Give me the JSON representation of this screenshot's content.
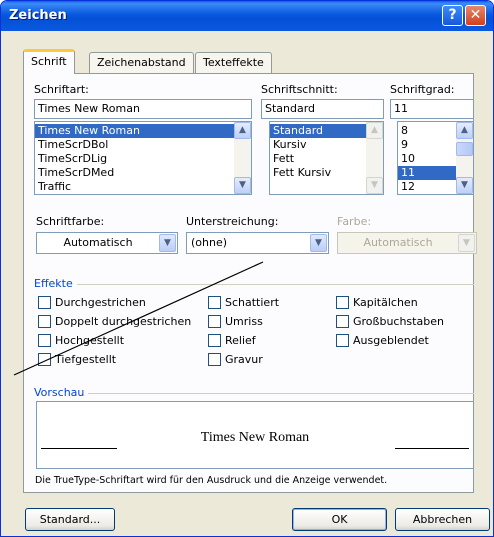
{
  "window": {
    "title": "Zeichen",
    "help_symbol": "?",
    "close_symbol": "✕"
  },
  "tabs": [
    {
      "label": "Schrift",
      "active": true
    },
    {
      "label": "Zeichenabstand",
      "active": false
    },
    {
      "label": "Texteffekte",
      "active": false
    }
  ],
  "font": {
    "label": "Schriftart:",
    "value": "Times New Roman",
    "items": [
      "Times New Roman",
      "TimeScrDBol",
      "TimeScrDLig",
      "TimeScrDMed",
      "Traffic"
    ]
  },
  "style": {
    "label": "Schriftschnitt:",
    "value": "Standard",
    "items": [
      "Standard",
      "Kursiv",
      "Fett",
      "Fett Kursiv"
    ]
  },
  "size": {
    "label": "Schriftgrad:",
    "value": "11",
    "items": [
      "8",
      "9",
      "10",
      "11",
      "12"
    ]
  },
  "color": {
    "label": "Schriftfarbe:",
    "value": "Automatisch"
  },
  "underline": {
    "label": "Unterstreichung:",
    "value": "(ohne)"
  },
  "underline_color": {
    "label": "Farbe:",
    "value": "Automatisch"
  },
  "effects": {
    "title": "Effekte",
    "items": [
      "Durchgestrichen",
      "Doppelt durchgestrichen",
      "Hochgestellt",
      "Tiefgestellt",
      "Schattiert",
      "Umriss",
      "Relief",
      "Gravur",
      "Kapitälchen",
      "Großbuchstaben",
      "Ausgeblendet"
    ]
  },
  "preview": {
    "title": "Vorschau",
    "sample": "Times New Roman",
    "info": "Die TrueType-Schriftart wird für den Ausdruck und die Anzeige verwendet."
  },
  "buttons": {
    "default": "Standard...",
    "ok": "OK",
    "cancel": "Abbrechen"
  },
  "icons": {
    "scroll_up": "up-arrow-icon",
    "scroll_down": "down-arrow-icon",
    "dropdown": "chevron-down-icon"
  }
}
